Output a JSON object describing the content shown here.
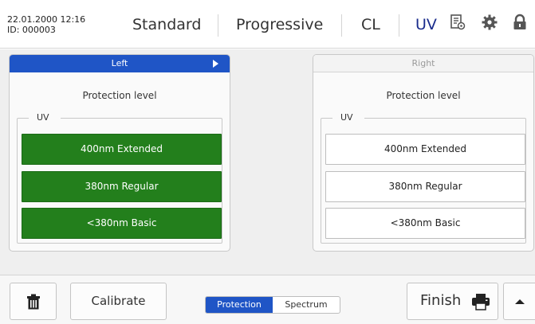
{
  "header": {
    "datetime": "22.01.2000 12:16",
    "id_label": "ID: 000003",
    "tabs": {
      "standard": "Standard",
      "progressive": "Progressive",
      "cl": "CL",
      "uv": "UV"
    },
    "active_tab_color": "#1a2c8c",
    "icons": [
      "settings-list-icon",
      "gear-icon",
      "lock-icon"
    ]
  },
  "left_panel": {
    "title": "Left",
    "state": "active",
    "protection_label": "Protection level",
    "group_label": "UV",
    "options": [
      "400nm Extended",
      "380nm Regular",
      "<380nm Basic"
    ],
    "option_color": "#237f1c",
    "header_color": "#1f55c6"
  },
  "right_panel": {
    "title": "Right",
    "state": "inactive",
    "protection_label": "Protection level",
    "group_label": "UV",
    "options": [
      "400nm Extended",
      "380nm Regular",
      "<380nm Basic"
    ]
  },
  "footer": {
    "calibrate_label": "Calibrate",
    "toggle": {
      "options": [
        "Protection",
        "Spectrum"
      ],
      "selected": "Protection"
    },
    "finish_label": "Finish",
    "icons": [
      "trash-icon",
      "printer-icon",
      "chevron-up-icon"
    ]
  }
}
